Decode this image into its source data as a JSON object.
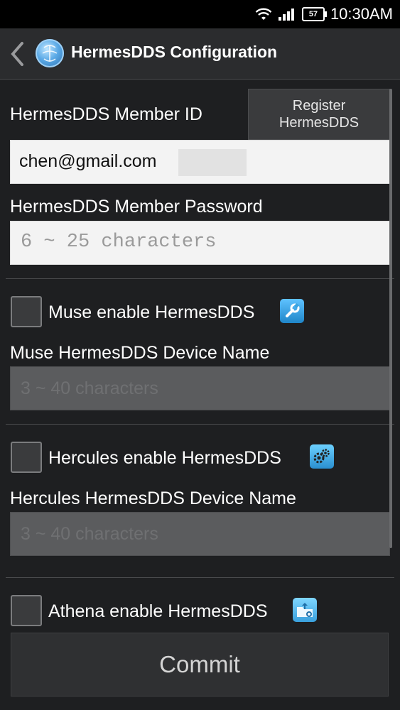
{
  "status_bar": {
    "time": "10:30AM",
    "battery": "57"
  },
  "action_bar": {
    "title": "HermesDDS Configuration"
  },
  "member_id": {
    "label": "HermesDDS Member ID",
    "value": "chen@gmail.com"
  },
  "register_button": {
    "label": "Register\nHermesDDS"
  },
  "member_password": {
    "label": "HermesDDS Member Password",
    "placeholder": "6 ~ 25 characters"
  },
  "muse": {
    "checkbox_label": "Muse enable HermesDDS",
    "device_name_label": "Muse HermesDDS Device Name",
    "device_name_placeholder": "3 ~ 40 characters",
    "icon": "wrench-icon"
  },
  "hercules": {
    "checkbox_label": "Hercules enable HermesDDS",
    "device_name_label": "Hercules HermesDDS Device Name",
    "device_name_placeholder": "3 ~ 40 characters",
    "icon": "gears-icon"
  },
  "athena": {
    "checkbox_label": "Athena enable HermesDDS",
    "icon": "folder-upload-icon"
  },
  "commit_button": {
    "label": "Commit"
  }
}
